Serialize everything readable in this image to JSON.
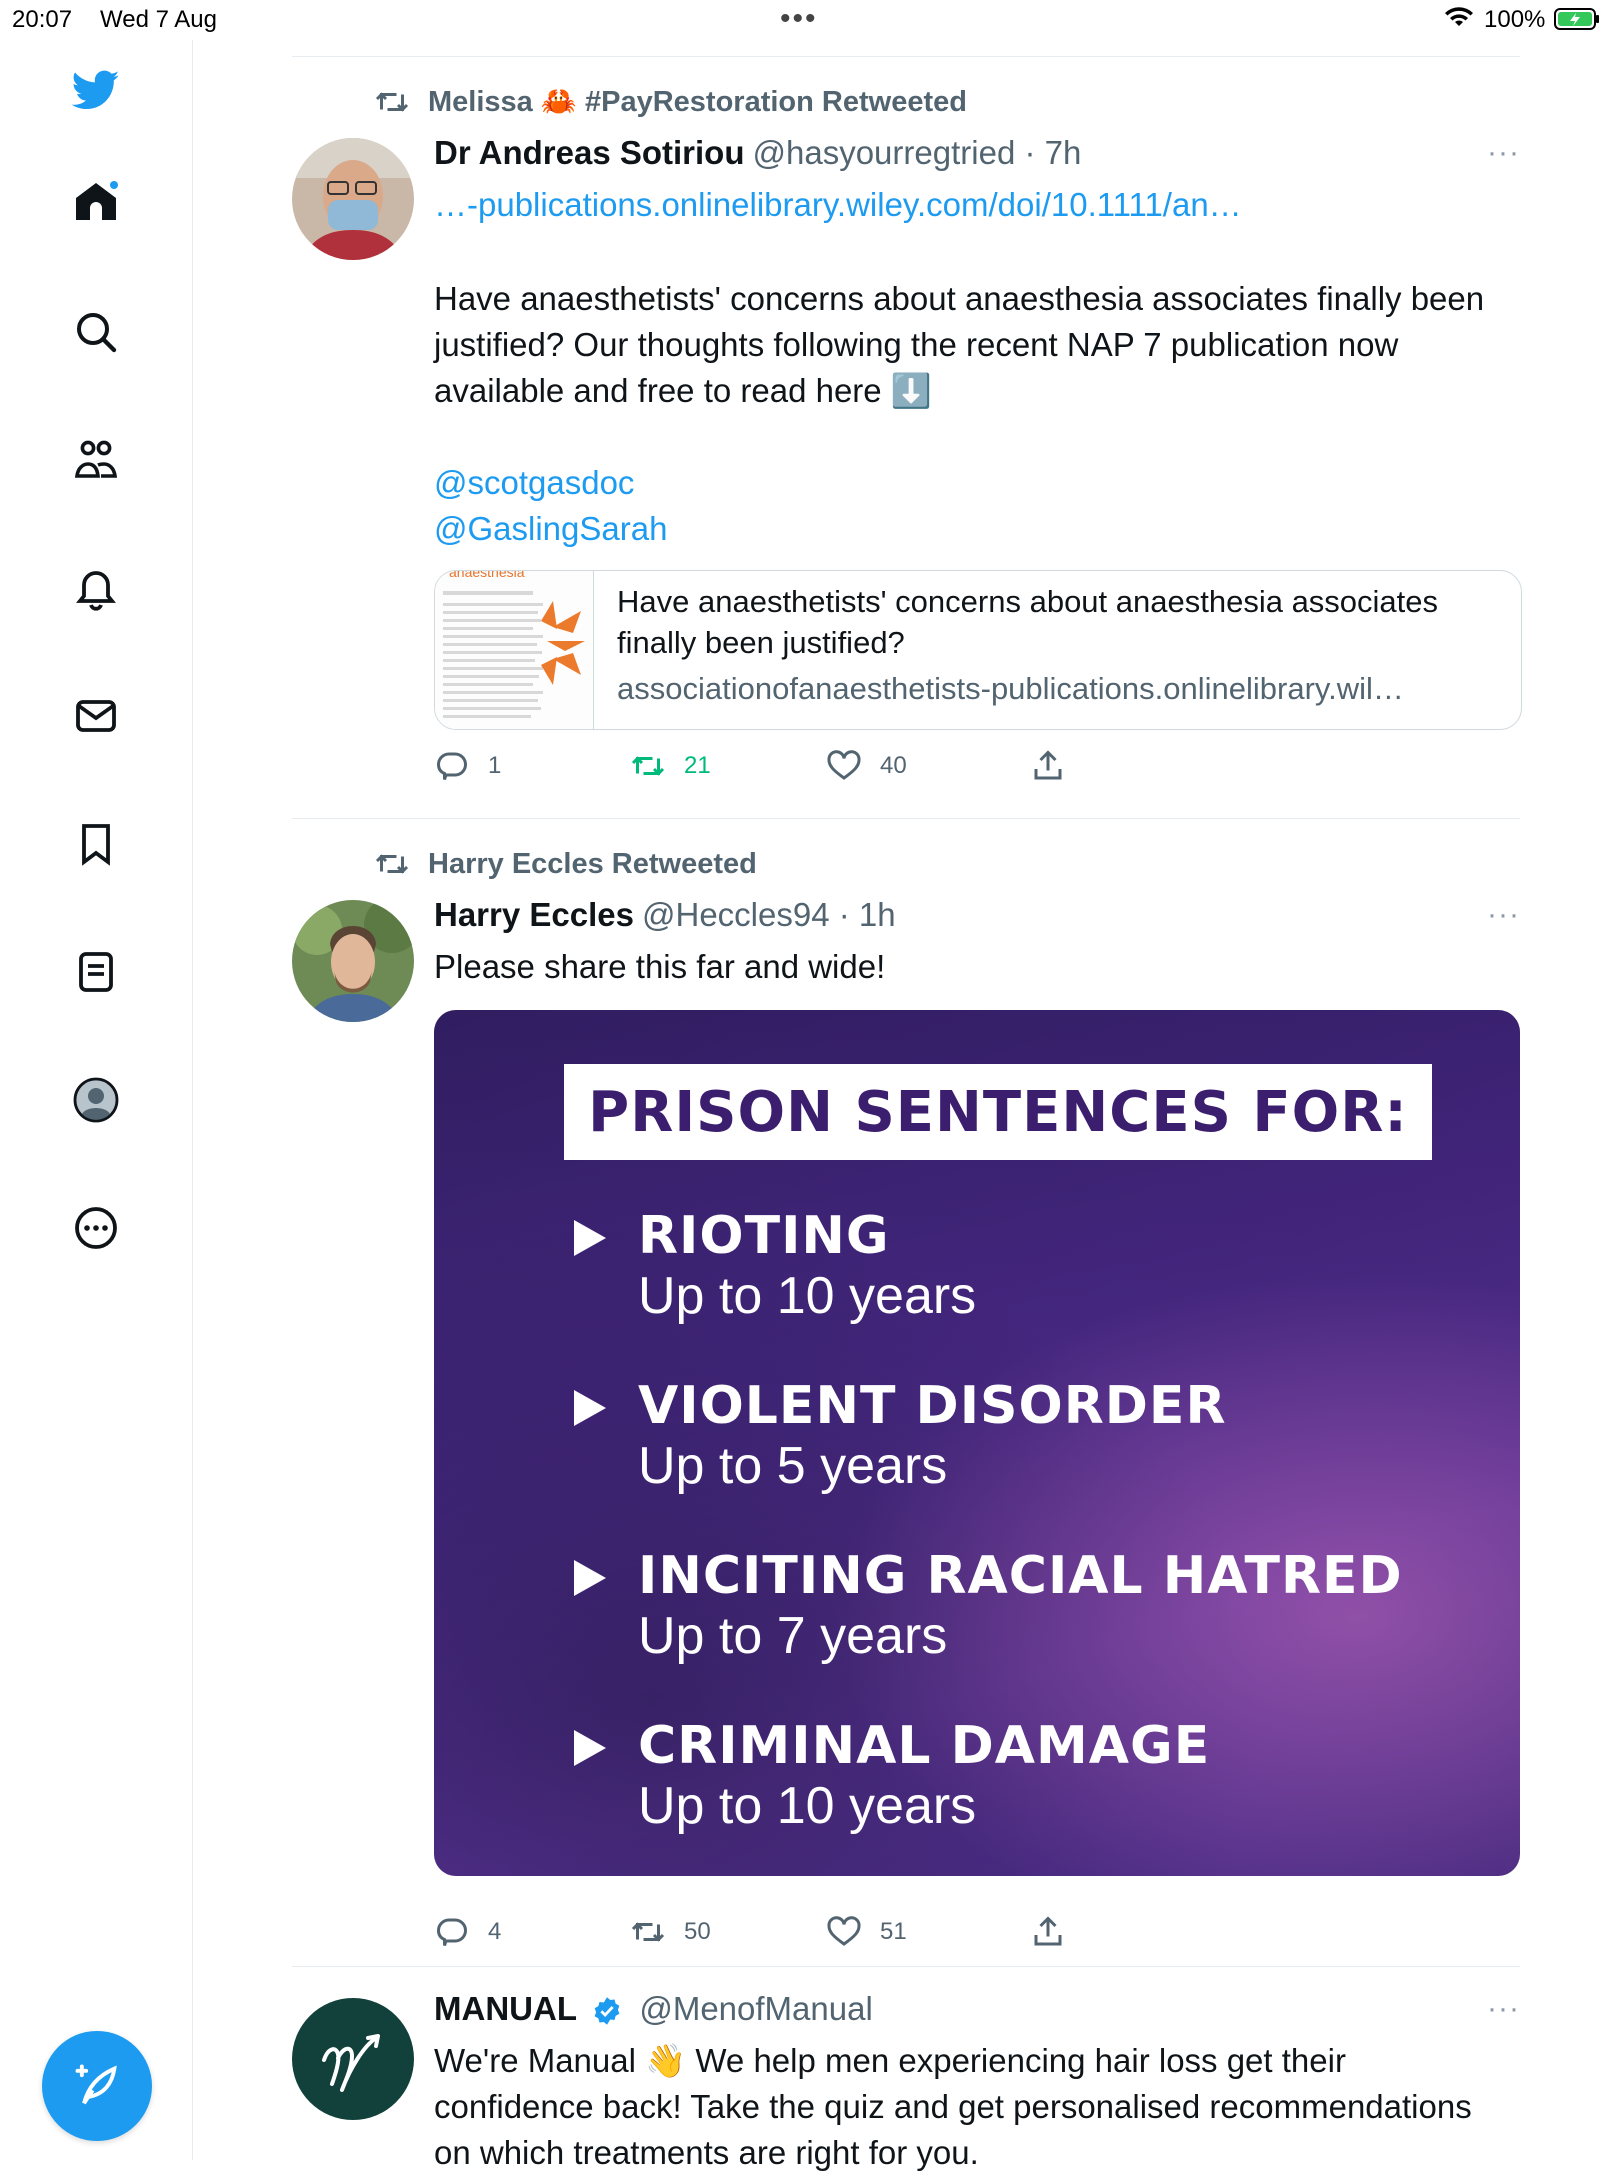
{
  "status_bar": {
    "time": "20:07",
    "date": "Wed 7 Aug",
    "battery": "100%"
  },
  "sidebar": {
    "items": [
      "twitter-logo",
      "home",
      "search",
      "communities",
      "notifications",
      "messages",
      "bookmarks",
      "lists",
      "profile",
      "more"
    ]
  },
  "tweets": [
    {
      "retweeted_by": "Melissa 🦀 #PayRestoration Retweeted",
      "name": "Dr Andreas Sotiriou",
      "handle": "@hasyourregtried · 7h",
      "link_text": "…-publications.onlinelibrary.wiley.com/doi/10.1111/an…",
      "text": "Have anaesthetists' concerns about anaesthesia associates finally been justified? Our thoughts following the recent NAP 7 publication now available and free to read here ⬇️",
      "mentions": [
        "@scotgasdoc",
        "@GaslingSarah"
      ],
      "card": {
        "title": "Have anaesthetists' concerns about anaesthesia associates finally been justified?",
        "domain": "associationofanaesthetists-publications.onlinelibrary.wil…"
      },
      "replies": "1",
      "retweets": "21",
      "likes": "40"
    },
    {
      "retweeted_by": "Harry Eccles Retweeted",
      "name": "Harry Eccles",
      "handle": "@Heccles94 · 1h",
      "text": "Please share this far and wide!",
      "media": {
        "banner": "PRISON SENTENCES FOR:",
        "items": [
          {
            "heading": "RIOTING",
            "sub": "Up to 10 years"
          },
          {
            "heading": "VIOLENT DISORDER",
            "sub": "Up to 5 years"
          },
          {
            "heading": "INCITING RACIAL HATRED",
            "sub": "Up to 7 years"
          },
          {
            "heading": "CRIMINAL DAMAGE",
            "sub": "Up to 10 years"
          }
        ]
      },
      "replies": "4",
      "retweets": "50",
      "likes": "51"
    },
    {
      "name": "MANUAL",
      "handle": "@MenofManual",
      "text": "We're Manual 👋 We help men experiencing hair loss get their confidence back! Take the quiz and get personalised recommendations on which treatments are right for you."
    }
  ],
  "colors": {
    "accent": "#1d9bf0",
    "retweet_green": "#00ba7c",
    "muted": "#536471",
    "media_purple": "#4b2a8a"
  }
}
